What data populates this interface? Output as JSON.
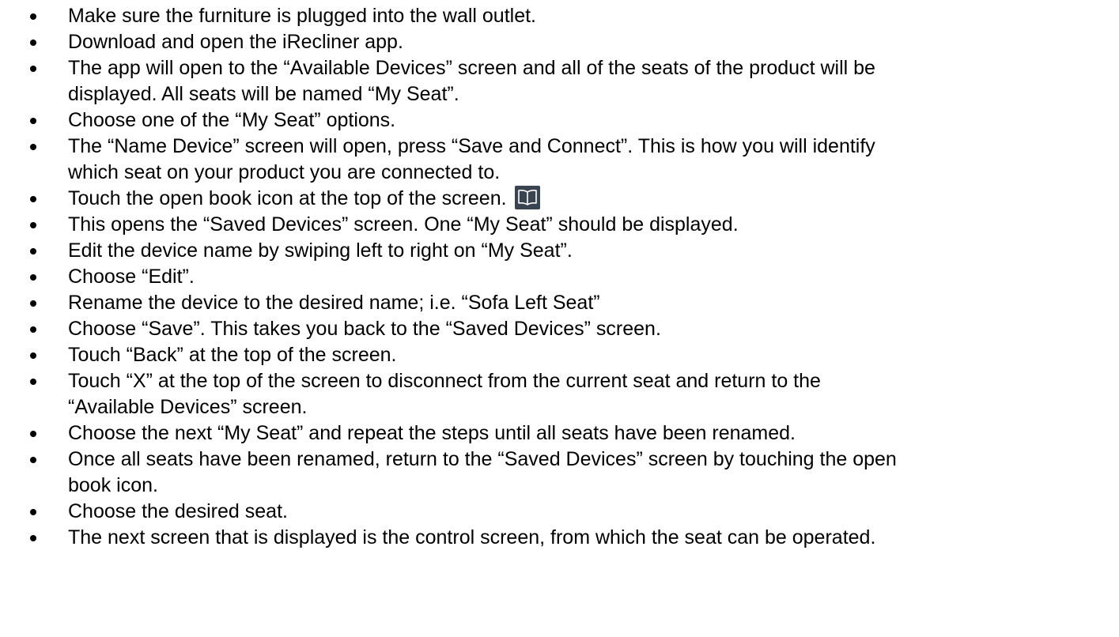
{
  "document": {
    "steps": [
      {
        "lines": [
          "Make sure the furniture is plugged into the wall outlet."
        ]
      },
      {
        "lines": [
          "Download and open the iRecliner app."
        ]
      },
      {
        "lines": [
          "The app will open to the “Available Devices” screen and all of the seats of the product will be",
          "displayed.  All seats will be named “My Seat”."
        ]
      },
      {
        "lines": [
          "Choose one of the “My Seat” options."
        ]
      },
      {
        "lines": [
          "The “Name Device” screen will open, press “Save and Connect”. This is how you will identify",
          "which seat on your product you are connected to."
        ]
      },
      {
        "lines": [
          "Touch the open book icon at the top of the screen."
        ],
        "icon": "open-book-icon"
      },
      {
        "lines": [
          "This opens the “Saved Devices” screen.  One “My Seat” should be displayed."
        ]
      },
      {
        "lines": [
          "Edit the device name by swiping left to right on “My Seat”."
        ]
      },
      {
        "lines": [
          "Choose “Edit”."
        ]
      },
      {
        "lines": [
          "Rename the device to the desired name; i.e. “Sofa Left Seat”"
        ]
      },
      {
        "lines": [
          "Choose “Save”.  This takes you back to the “Saved Devices” screen."
        ]
      },
      {
        "lines": [
          "Touch “Back” at the top of the screen."
        ]
      },
      {
        "lines": [
          "Touch “X” at the top of the screen to disconnect from the current seat and return to the",
          "“Available Devices” screen."
        ]
      },
      {
        "lines": [
          "Choose the next “My Seat” and repeat the steps until all seats have been renamed."
        ]
      },
      {
        "lines": [
          "Once all seats have been renamed, return to the “Saved Devices” screen by touching the open",
          "book icon."
        ]
      },
      {
        "lines": [
          "Choose the desired seat."
        ]
      },
      {
        "lines": [
          "The next screen that is displayed is the control screen, from which the seat can be operated."
        ]
      }
    ]
  },
  "colors": {
    "text": "#000000",
    "icon_background": "#3a4350",
    "icon_stroke": "#ffffff"
  }
}
